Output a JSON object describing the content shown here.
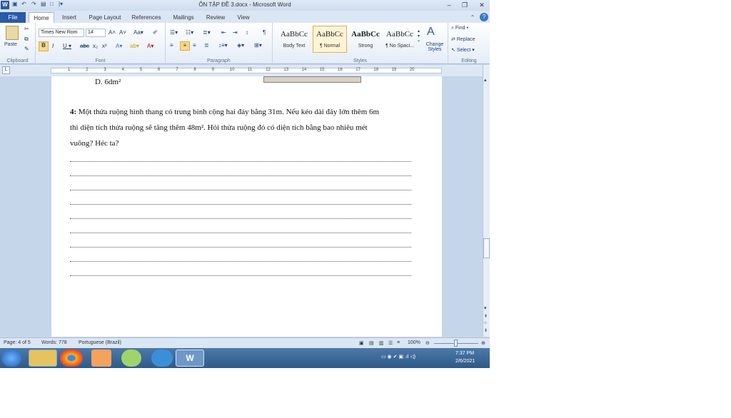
{
  "window": {
    "title": "ÔN TẬP ĐỀ 3.docx - Microsoft Word"
  },
  "tabs": [
    "File",
    "Home",
    "Insert",
    "Page Layout",
    "References",
    "Mailings",
    "Review",
    "View"
  ],
  "ribbon": {
    "clipboard": {
      "paste": "Paste",
      "label": "Clipboard"
    },
    "font": {
      "name": "Times New Rom",
      "size": "14",
      "label": "Font"
    },
    "paragraph": {
      "label": "Paragraph"
    },
    "styles": {
      "label": "Styles",
      "items": [
        {
          "preview": "AaBbCc",
          "name": "Body Text"
        },
        {
          "preview": "AaBbCc",
          "name": "¶ Normal"
        },
        {
          "preview": "AaBbCc",
          "name": "Strong"
        },
        {
          "preview": "AaBbCc",
          "name": "¶ No Spaci..."
        }
      ],
      "change": "Change Styles"
    },
    "editing": {
      "find": "Find",
      "replace": "Replace",
      "select": "Select",
      "label": "Editing"
    }
  },
  "ruler": {
    "numbers": [
      "1",
      "2",
      "3",
      "4",
      "5",
      "6",
      "7",
      "8",
      "9",
      "10",
      "11",
      "12",
      "13",
      "14",
      "15",
      "16",
      "17",
      "18",
      "19",
      "20"
    ]
  },
  "document": {
    "option_d": "D.   6dm²",
    "q_num": "4:",
    "line1": " Một thửa ruộng hình thang có trung bình cộng hai đáy bằng 31m. Nếu kéo dài đáy lớn thêm 6m",
    "line2": "thì diện tích thửa ruộng sẽ tăng thêm 48m². Hỏi thửa ruộng đó có diện tích bằng bao nhiêu mét",
    "line3": "vuông? Héc ta?"
  },
  "status": {
    "page": "Page: 4 of 5",
    "words": "Words: 778",
    "language": "Portuguese (Brazil)",
    "zoom": "100%"
  },
  "taskbar": {
    "time": "7:37 PM",
    "date": "2/6/2021"
  }
}
